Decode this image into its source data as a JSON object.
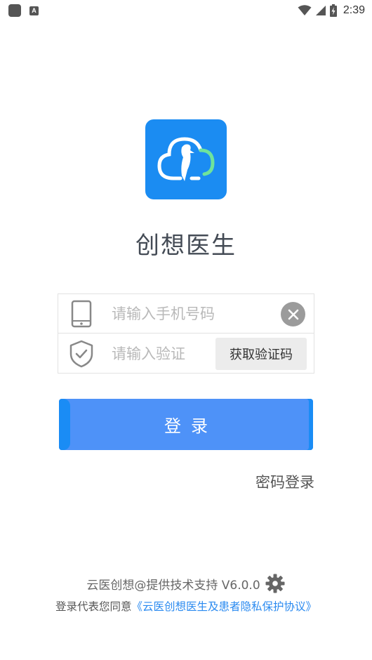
{
  "status_bar": {
    "time": "2:39",
    "notification_badge": "A"
  },
  "app": {
    "title": "创想医生",
    "brand_color": "#1b8cf2"
  },
  "form": {
    "phone_placeholder": "请输入手机号码",
    "code_placeholder": "请输入验证",
    "get_code_label": "获取验证码"
  },
  "actions": {
    "login_label": "登录",
    "password_login_label": "密码登录"
  },
  "footer": {
    "support_text": "云医创想@提供技术支持 V6.0.0",
    "agree_prefix": "登录代表您同意",
    "agree_link": "《云医创想医生及患者隐私保护协议》"
  }
}
